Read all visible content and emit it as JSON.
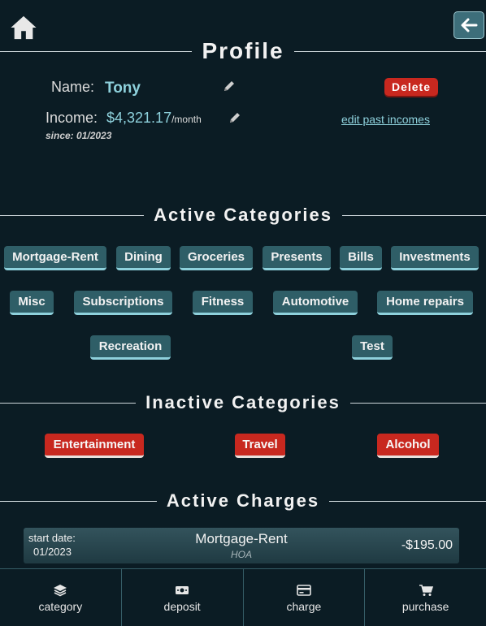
{
  "profile": {
    "title": "Profile",
    "name_label": "Name:",
    "name_value": "Tony",
    "delete_label": "Delete",
    "income_label": "Income:",
    "income_value": "$4,321.17",
    "income_unit": "/month",
    "since_text": "since: 01/2023",
    "edit_past_incomes": "edit past incomes"
  },
  "active_categories": {
    "title": "Active Categories",
    "items": [
      "Mortgage-Rent",
      "Dining",
      "Groceries",
      "Presents",
      "Bills",
      "Investments",
      "Misc",
      "Subscriptions",
      "Fitness",
      "Automotive",
      "Home repairs",
      "Recreation",
      "Test"
    ]
  },
  "inactive_categories": {
    "title": "Inactive Categories",
    "items": [
      "Entertainment",
      "Travel",
      "Alcohol"
    ]
  },
  "active_charges": {
    "title": "Active Charges",
    "items": [
      {
        "start_label": "start date:",
        "start_date": "01/2023",
        "category": "Mortgage-Rent",
        "subtitle": "HOA",
        "amount": "-$195.00"
      }
    ]
  },
  "tabs": [
    {
      "label": "category",
      "icon": "layers-icon"
    },
    {
      "label": "deposit",
      "icon": "money-icon"
    },
    {
      "label": "charge",
      "icon": "credit-card-icon"
    },
    {
      "label": "purchase",
      "icon": "cart-icon"
    }
  ],
  "colors": {
    "background": "#0b1c24",
    "chip": "#2f5e67",
    "chip_inactive": "#c8281f",
    "accent": "#8ed1dc"
  }
}
